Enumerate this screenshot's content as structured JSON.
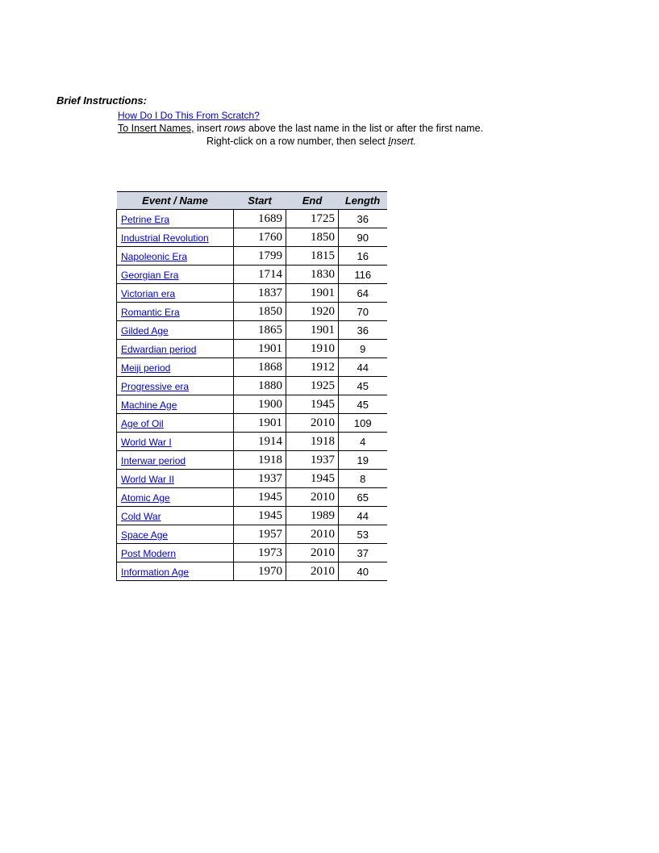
{
  "heading": "Brief Instructions:",
  "how_link": "How Do I Do This From Scratch?",
  "instr1": {
    "lead": "To Insert Names,",
    "mid1": " insert ",
    "rows": "rows",
    "rest": " above the last name in the list or after the first name."
  },
  "instr2": {
    "pre": "Right-click on a row number, then select   ",
    "insert_italic": "I",
    "insert_rest": "nsert."
  },
  "table": {
    "headers": {
      "event": "Event / Name",
      "start": "Start",
      "end": "End",
      "length": "Length"
    },
    "rows": [
      {
        "name": "Petrine Era",
        "start": 1689,
        "end": 1725,
        "length": 36
      },
      {
        "name": "Industrial Revolution",
        "start": 1760,
        "end": 1850,
        "length": 90
      },
      {
        "name": "Napoleonic Era",
        "start": 1799,
        "end": 1815,
        "length": 16
      },
      {
        "name": "Georgian Era",
        "start": 1714,
        "end": 1830,
        "length": 116
      },
      {
        "name": "Victorian era",
        "start": 1837,
        "end": 1901,
        "length": 64
      },
      {
        "name": "Romantic Era",
        "start": 1850,
        "end": 1920,
        "length": 70
      },
      {
        "name": "Gilded Age",
        "start": 1865,
        "end": 1901,
        "length": 36
      },
      {
        "name": "Edwardian period",
        "start": 1901,
        "end": 1910,
        "length": 9
      },
      {
        "name": "Meiji period",
        "start": 1868,
        "end": 1912,
        "length": 44
      },
      {
        "name": "Progressive era",
        "start": 1880,
        "end": 1925,
        "length": 45
      },
      {
        "name": "Machine Age",
        "start": 1900,
        "end": 1945,
        "length": 45
      },
      {
        "name": "Age of Oil",
        "start": 1901,
        "end": 2010,
        "length": 109
      },
      {
        "name": "World War I",
        "start": 1914,
        "end": 1918,
        "length": 4
      },
      {
        "name": "Interwar period",
        "start": 1918,
        "end": 1937,
        "length": 19
      },
      {
        "name": "World War II",
        "start": 1937,
        "end": 1945,
        "length": 8
      },
      {
        "name": "Atomic Age",
        "start": 1945,
        "end": 2010,
        "length": 65
      },
      {
        "name": "Cold War",
        "start": 1945,
        "end": 1989,
        "length": 44
      },
      {
        "name": "Space Age",
        "start": 1957,
        "end": 2010,
        "length": 53
      },
      {
        "name": "Post Modern",
        "start": 1973,
        "end": 2010,
        "length": 37
      },
      {
        "name": "Information Age",
        "start": 1970,
        "end": 2010,
        "length": 40
      }
    ]
  }
}
